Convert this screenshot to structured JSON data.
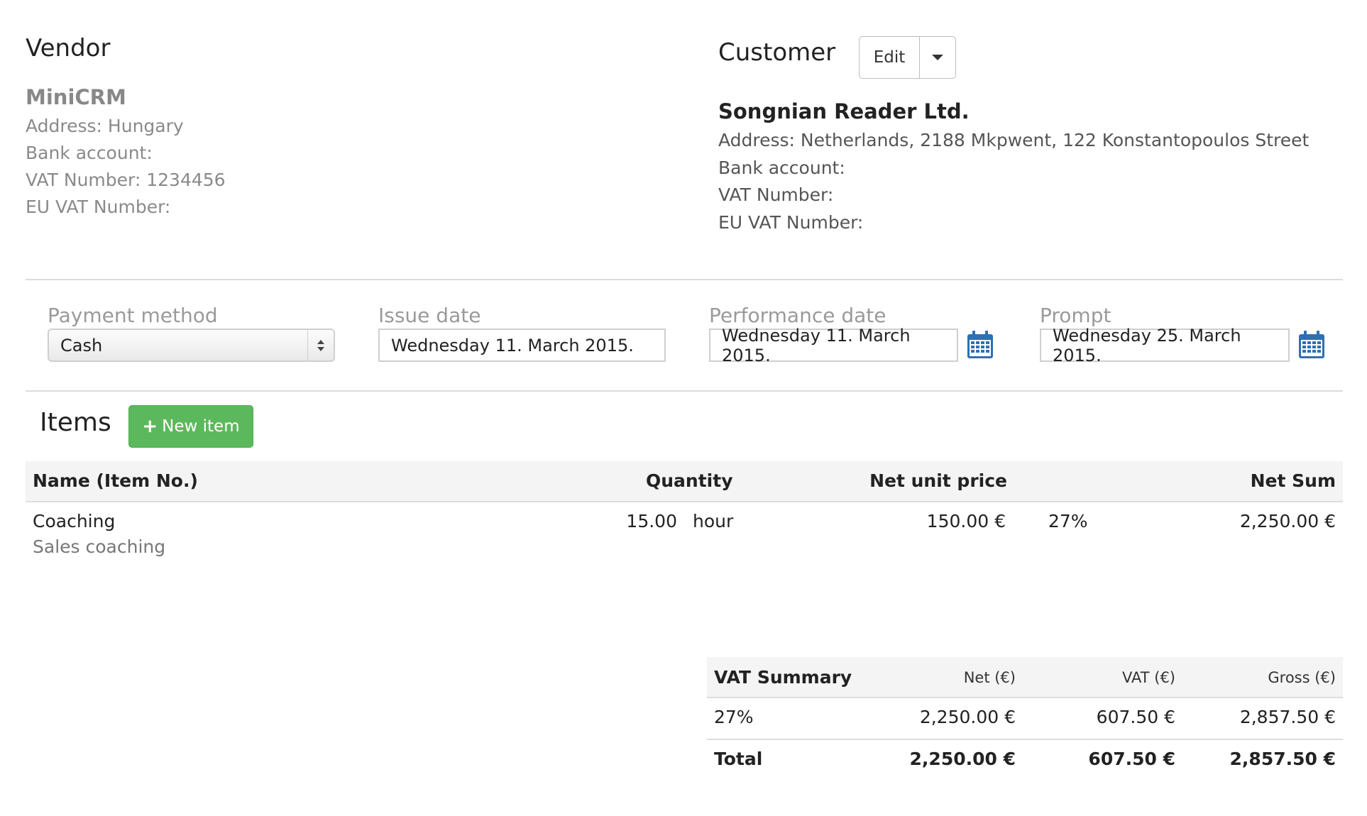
{
  "vendor": {
    "title": "Vendor",
    "name": "MiniCRM",
    "address": "Address: Hungary",
    "bank_account": "Bank account:",
    "vat_number": "VAT Number: 1234456",
    "eu_vat_number": "EU VAT Number:"
  },
  "customer": {
    "title": "Customer",
    "edit_label": "Edit",
    "name": "Songnian Reader Ltd.",
    "address": "Address: Netherlands, 2188 Mkpwent, 122 Konstantopoulos Street",
    "bank_account": "Bank account:",
    "vat_number": "VAT Number:",
    "eu_vat_number": "EU VAT Number:"
  },
  "form": {
    "payment_method": {
      "label": "Payment method",
      "value": "Cash"
    },
    "issue_date": {
      "label": "Issue date",
      "value": "Wednesday 11. March 2015."
    },
    "performance_date": {
      "label": "Performance date",
      "value": "Wednesday 11. March 2015."
    },
    "prompt": {
      "label": "Prompt",
      "value": "Wednesday 25. March 2015."
    }
  },
  "items": {
    "title": "Items",
    "new_item_label": "New item",
    "columns": {
      "name": "Name (Item No.)",
      "quantity": "Quantity",
      "net_unit_price": "Net unit price",
      "net_sum": "Net Sum"
    },
    "rows": [
      {
        "name": "Coaching",
        "description": "Sales coaching",
        "quantity": "15.00",
        "unit": "hour",
        "net_unit_price": "150.00 €",
        "vat": "27%",
        "net_sum": "2,250.00 €"
      }
    ]
  },
  "vat_summary": {
    "title": "VAT Summary",
    "columns": {
      "net": "Net (€)",
      "vat": "VAT (€)",
      "gross": "Gross (€)"
    },
    "rows": [
      {
        "rate": "27%",
        "net": "2,250.00 €",
        "vat": "607.50 €",
        "gross": "2,857.50 €"
      }
    ],
    "total": {
      "label": "Total",
      "net": "2,250.00 €",
      "vat": "607.50 €",
      "gross": "2,857.50 €"
    }
  },
  "colors": {
    "accent_green": "#5cb85c",
    "calendar_blue": "#2f6fb3"
  },
  "icons": {
    "calendar": "calendar-icon",
    "plus": "plus-icon",
    "caret": "caret-down-icon"
  }
}
